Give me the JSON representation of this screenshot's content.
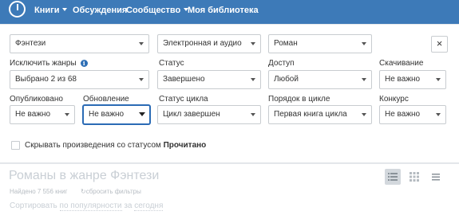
{
  "navbar": {
    "items": [
      {
        "label": "Книги",
        "has_caret": true
      },
      {
        "label": "Обсуждения",
        "has_caret": false
      },
      {
        "label": "Сообщество",
        "has_caret": true
      },
      {
        "label": "Моя библиотека",
        "has_caret": false
      }
    ],
    "background": "#3d7ab8"
  },
  "filters": {
    "genre": {
      "value": "Фэнтези"
    },
    "format": {
      "value": "Электронная и аудио"
    },
    "form": {
      "value": "Роман"
    },
    "close_label": "×",
    "exclude_genres": {
      "label": "Исключить жанры",
      "value": "Выбрано 2 из 68"
    },
    "status": {
      "label": "Статус",
      "value": "Завершено"
    },
    "access": {
      "label": "Доступ",
      "value": "Любой"
    },
    "download": {
      "label": "Скачивание",
      "value": "Не важно"
    },
    "published": {
      "label": "Опубликовано",
      "value": "Не важно"
    },
    "updated": {
      "label": "Обновление",
      "value": "Не важно"
    },
    "series_status": {
      "label": "Статус цикла",
      "value": "Цикл завершен"
    },
    "series_order": {
      "label": "Порядок в цикле",
      "value": "Первая книга цикла"
    },
    "contest": {
      "label": "Конкурс",
      "value": "Не важно"
    },
    "hide_read": {
      "label_prefix": "Скрывать произведения со статусом",
      "label_bold": "Прочитано",
      "checked": false
    }
  },
  "results": {
    "title": "Романы в жанре Фэнтези",
    "found": "Найдено 7 556 книг",
    "reset": "сбросить фильтры",
    "sort": {
      "prefix": "Сортировать",
      "by": "по популярности",
      "period_prefix": "за",
      "period": "сегодня"
    },
    "view_modes": [
      "list-view-icon",
      "grid-view-icon",
      "compact-view-icon"
    ],
    "active_view": "list-view-icon"
  }
}
